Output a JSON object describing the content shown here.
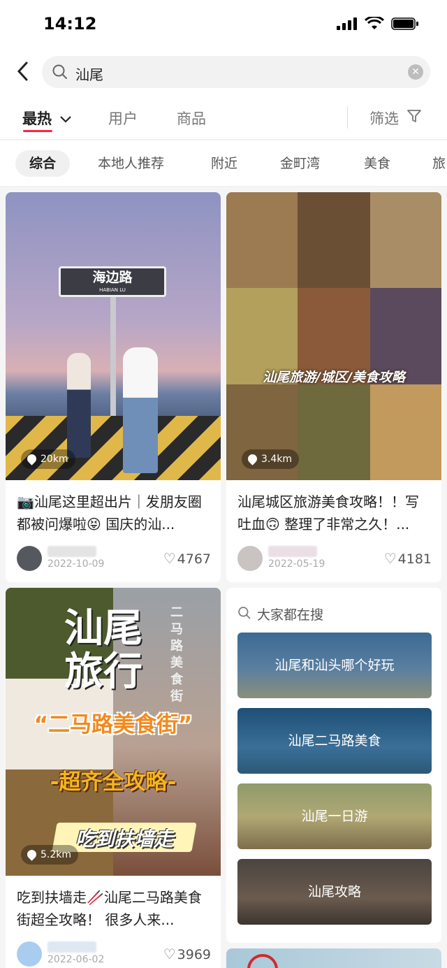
{
  "status_bar": {
    "time": "14:12"
  },
  "search": {
    "query": "汕尾"
  },
  "tabs": {
    "items": [
      "最热",
      "用户",
      "商品"
    ],
    "filter_label": "筛选"
  },
  "chips": [
    "综合",
    "本地人推荐",
    "附近",
    "金町湾",
    "美食",
    "旅"
  ],
  "posts": [
    {
      "distance": "20km",
      "sign_text": "海边路",
      "sign_sub": "HABIAN LU",
      "title": "📷汕尾这里超出片｜发朋友圈都被问爆啦😝 国庆的汕...",
      "date": "2022-10-09",
      "likes": "4767"
    },
    {
      "distance": "3.4km",
      "overlay_text": "汕尾旅游/城区/美食攻略",
      "title": "汕尾城区旅游美食攻略！！写吐血🙃 整理了非常之久！...",
      "date": "2022-05-19",
      "likes": "4181"
    },
    {
      "distance": "5.2km",
      "overlay_big1": "汕尾",
      "overlay_big2": "旅行",
      "overlay_street": "二马路美食街",
      "overlay_quote": "“二马路美食街”",
      "overlay_full": "-超齐全攻略-",
      "overlay_eat": "吃到扶墙走",
      "title": "吃到扶墙走🥢汕尾二马路美食街超全攻略！ 很多人来...",
      "date": "2022-06-02",
      "likes": "3969"
    }
  ],
  "trending": {
    "title": "大家都在搜",
    "items": [
      "汕尾和汕头哪个好玩",
      "汕尾二马路美食",
      "汕尾一日游",
      "汕尾攻略"
    ]
  },
  "colors": {
    "accent": "#ff2442"
  }
}
